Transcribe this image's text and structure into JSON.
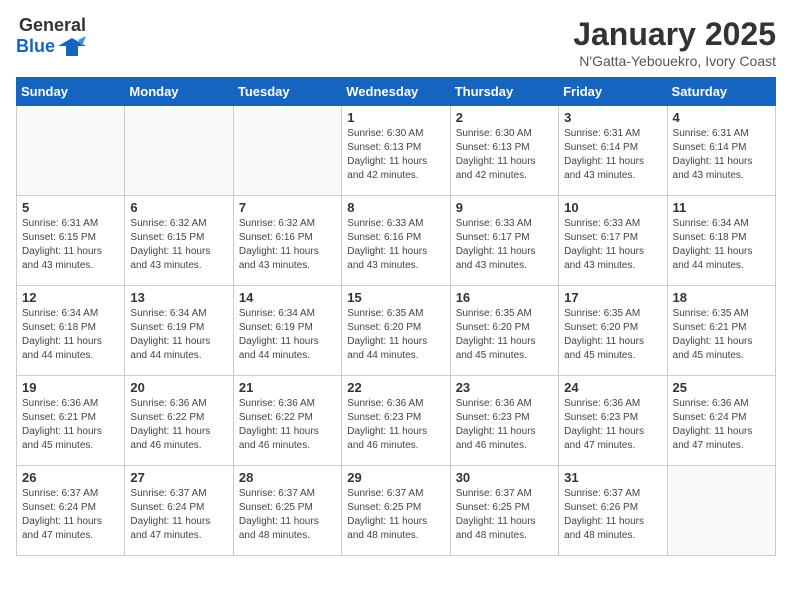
{
  "header": {
    "logo_general": "General",
    "logo_blue": "Blue",
    "title": "January 2025",
    "subtitle": "N'Gatta-Yebouekro, Ivory Coast"
  },
  "weekdays": [
    "Sunday",
    "Monday",
    "Tuesday",
    "Wednesday",
    "Thursday",
    "Friday",
    "Saturday"
  ],
  "weeks": [
    [
      {
        "day": "",
        "info": ""
      },
      {
        "day": "",
        "info": ""
      },
      {
        "day": "",
        "info": ""
      },
      {
        "day": "1",
        "info": "Sunrise: 6:30 AM\nSunset: 6:13 PM\nDaylight: 11 hours\nand 42 minutes."
      },
      {
        "day": "2",
        "info": "Sunrise: 6:30 AM\nSunset: 6:13 PM\nDaylight: 11 hours\nand 42 minutes."
      },
      {
        "day": "3",
        "info": "Sunrise: 6:31 AM\nSunset: 6:14 PM\nDaylight: 11 hours\nand 43 minutes."
      },
      {
        "day": "4",
        "info": "Sunrise: 6:31 AM\nSunset: 6:14 PM\nDaylight: 11 hours\nand 43 minutes."
      }
    ],
    [
      {
        "day": "5",
        "info": "Sunrise: 6:31 AM\nSunset: 6:15 PM\nDaylight: 11 hours\nand 43 minutes."
      },
      {
        "day": "6",
        "info": "Sunrise: 6:32 AM\nSunset: 6:15 PM\nDaylight: 11 hours\nand 43 minutes."
      },
      {
        "day": "7",
        "info": "Sunrise: 6:32 AM\nSunset: 6:16 PM\nDaylight: 11 hours\nand 43 minutes."
      },
      {
        "day": "8",
        "info": "Sunrise: 6:33 AM\nSunset: 6:16 PM\nDaylight: 11 hours\nand 43 minutes."
      },
      {
        "day": "9",
        "info": "Sunrise: 6:33 AM\nSunset: 6:17 PM\nDaylight: 11 hours\nand 43 minutes."
      },
      {
        "day": "10",
        "info": "Sunrise: 6:33 AM\nSunset: 6:17 PM\nDaylight: 11 hours\nand 43 minutes."
      },
      {
        "day": "11",
        "info": "Sunrise: 6:34 AM\nSunset: 6:18 PM\nDaylight: 11 hours\nand 44 minutes."
      }
    ],
    [
      {
        "day": "12",
        "info": "Sunrise: 6:34 AM\nSunset: 6:18 PM\nDaylight: 11 hours\nand 44 minutes."
      },
      {
        "day": "13",
        "info": "Sunrise: 6:34 AM\nSunset: 6:19 PM\nDaylight: 11 hours\nand 44 minutes."
      },
      {
        "day": "14",
        "info": "Sunrise: 6:34 AM\nSunset: 6:19 PM\nDaylight: 11 hours\nand 44 minutes."
      },
      {
        "day": "15",
        "info": "Sunrise: 6:35 AM\nSunset: 6:20 PM\nDaylight: 11 hours\nand 44 minutes."
      },
      {
        "day": "16",
        "info": "Sunrise: 6:35 AM\nSunset: 6:20 PM\nDaylight: 11 hours\nand 45 minutes."
      },
      {
        "day": "17",
        "info": "Sunrise: 6:35 AM\nSunset: 6:20 PM\nDaylight: 11 hours\nand 45 minutes."
      },
      {
        "day": "18",
        "info": "Sunrise: 6:35 AM\nSunset: 6:21 PM\nDaylight: 11 hours\nand 45 minutes."
      }
    ],
    [
      {
        "day": "19",
        "info": "Sunrise: 6:36 AM\nSunset: 6:21 PM\nDaylight: 11 hours\nand 45 minutes."
      },
      {
        "day": "20",
        "info": "Sunrise: 6:36 AM\nSunset: 6:22 PM\nDaylight: 11 hours\nand 46 minutes."
      },
      {
        "day": "21",
        "info": "Sunrise: 6:36 AM\nSunset: 6:22 PM\nDaylight: 11 hours\nand 46 minutes."
      },
      {
        "day": "22",
        "info": "Sunrise: 6:36 AM\nSunset: 6:23 PM\nDaylight: 11 hours\nand 46 minutes."
      },
      {
        "day": "23",
        "info": "Sunrise: 6:36 AM\nSunset: 6:23 PM\nDaylight: 11 hours\nand 46 minutes."
      },
      {
        "day": "24",
        "info": "Sunrise: 6:36 AM\nSunset: 6:23 PM\nDaylight: 11 hours\nand 47 minutes."
      },
      {
        "day": "25",
        "info": "Sunrise: 6:36 AM\nSunset: 6:24 PM\nDaylight: 11 hours\nand 47 minutes."
      }
    ],
    [
      {
        "day": "26",
        "info": "Sunrise: 6:37 AM\nSunset: 6:24 PM\nDaylight: 11 hours\nand 47 minutes."
      },
      {
        "day": "27",
        "info": "Sunrise: 6:37 AM\nSunset: 6:24 PM\nDaylight: 11 hours\nand 47 minutes."
      },
      {
        "day": "28",
        "info": "Sunrise: 6:37 AM\nSunset: 6:25 PM\nDaylight: 11 hours\nand 48 minutes."
      },
      {
        "day": "29",
        "info": "Sunrise: 6:37 AM\nSunset: 6:25 PM\nDaylight: 11 hours\nand 48 minutes."
      },
      {
        "day": "30",
        "info": "Sunrise: 6:37 AM\nSunset: 6:25 PM\nDaylight: 11 hours\nand 48 minutes."
      },
      {
        "day": "31",
        "info": "Sunrise: 6:37 AM\nSunset: 6:26 PM\nDaylight: 11 hours\nand 48 minutes."
      },
      {
        "day": "",
        "info": ""
      }
    ]
  ]
}
